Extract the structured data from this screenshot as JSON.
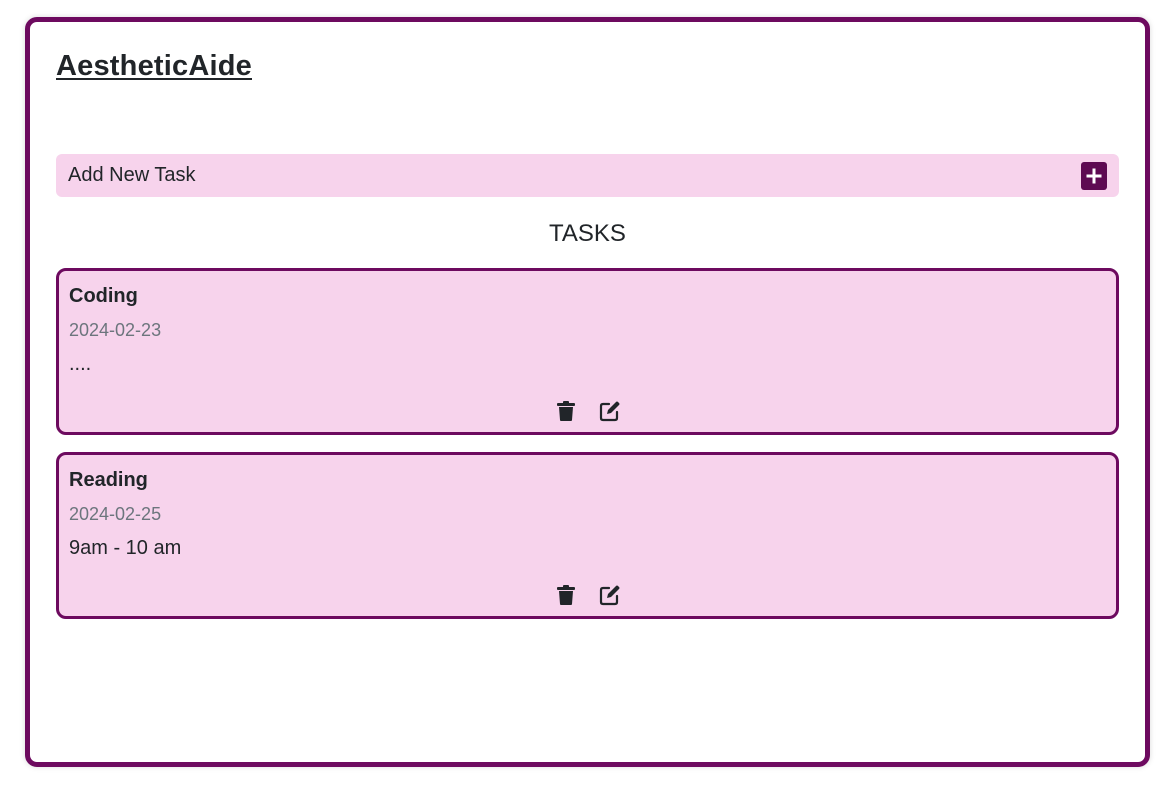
{
  "app": {
    "title": "AestheticAide"
  },
  "add_task": {
    "label": "Add New Task",
    "button_icon": "plus-square-icon"
  },
  "tasks_heading": "TASKS",
  "tasks": [
    {
      "title": "Coding",
      "date": "2024-02-23",
      "description": "....",
      "actions": [
        "trash-icon",
        "edit-icon"
      ]
    },
    {
      "title": "Reading",
      "date": "2024-02-25",
      "description": "9am - 10 am",
      "actions": [
        "trash-icon",
        "edit-icon"
      ]
    }
  ],
  "colors": {
    "frame_border": "#6d0a5f",
    "card_background": "#f7d3ec",
    "add_button": "#5e0a52",
    "date_text": "#6c757d"
  }
}
